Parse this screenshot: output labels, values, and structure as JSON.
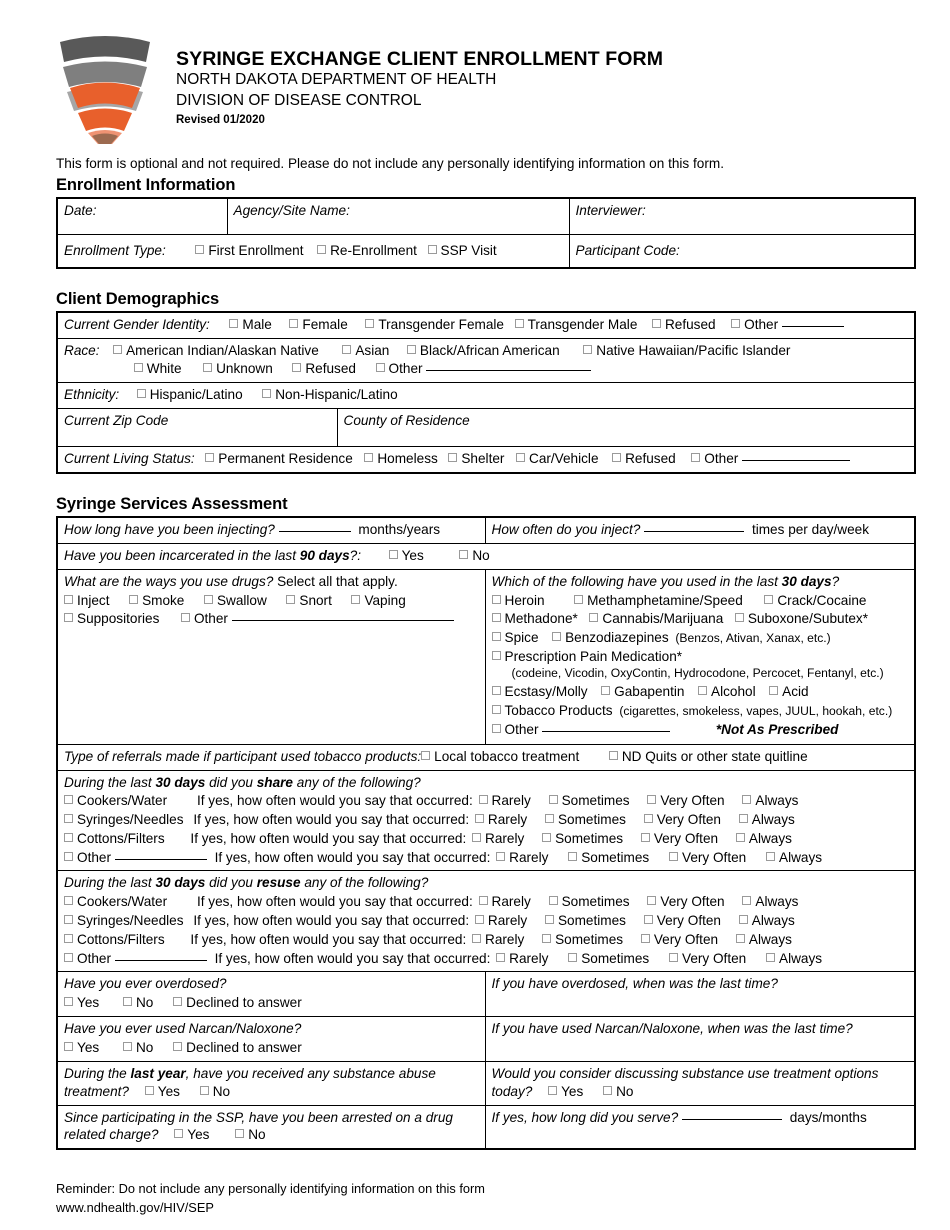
{
  "header": {
    "logo_name": "north-dakota-health-shield-logo",
    "title": "SYRINGE EXCHANGE CLIENT ENROLLMENT FORM",
    "org_line1": "NORTH DAKOTA DEPARTMENT OF HEALTH",
    "org_line2": "DIVISION OF DISEASE CONTROL",
    "revised": "Revised 01/2020",
    "colors": {
      "dark_gray": "#595959",
      "mid_gray": "#7f7f7f",
      "light_gray": "#a6a6a6",
      "orange": "#e8602c",
      "light_orange": "#ef9373",
      "brown": "#9c6a50"
    }
  },
  "intro": "This form is optional and not required.  Please do not include any personally identifying information on this form.",
  "sections": {
    "enrollment": {
      "heading": "Enrollment Information",
      "date_label": "Date:",
      "agency_label": "Agency/Site Name:",
      "interviewer_label": "Interviewer:",
      "enrollment_type_label": "Enrollment Type:",
      "enrollment_type_options": [
        "First Enrollment",
        "Re-Enrollment",
        "SSP Visit"
      ],
      "participant_code_label": "Participant Code:"
    },
    "demographics": {
      "heading": "Client Demographics",
      "gender_label": "Current Gender Identity:",
      "gender_options": [
        "Male",
        "Female",
        "Transgender Female",
        "Transgender Male",
        "Refused",
        "Other"
      ],
      "race_label": "Race:",
      "race_options_row1": [
        "American Indian/Alaskan Native",
        "Asian",
        "Black/African American",
        "Native Hawaiian/Pacific Islander"
      ],
      "race_options_row2": [
        "White",
        "Unknown",
        "Refused",
        "Other"
      ],
      "ethnicity_label": "Ethnicity:",
      "ethnicity_options": [
        "Hispanic/Latino",
        "Non-Hispanic/Latino"
      ],
      "zip_label": "Current Zip Code",
      "county_label": "County of Residence",
      "living_status_label": "Current Living Status:",
      "living_status_options": [
        "Permanent Residence",
        "Homeless",
        "Shelter",
        "Car/Vehicle",
        "Refused",
        "Other"
      ]
    },
    "assessment": {
      "heading": "Syringe Services Assessment",
      "how_long_q": "How long have you been injecting?",
      "how_long_unit": "months/years",
      "how_often_q": "How often do you inject?",
      "how_often_unit": "times per day/week",
      "incarcerated_q_a": "Have you been incarcerated in the last ",
      "incarcerated_q_bold": "90 days",
      "incarcerated_q_b": "?:",
      "incarcerated_options": [
        "Yes",
        "No"
      ],
      "ways_q": "What are the ways you use drugs?",
      "ways_q_tail": " Select all that apply.",
      "ways_options_row1": [
        "Inject",
        "Smoke",
        "Swallow",
        "Snort",
        "Vaping"
      ],
      "ways_options_row2": [
        "Suppositories",
        "Other"
      ],
      "used_q_a": "Which of the following have you used in the last ",
      "used_q_bold": "30 days",
      "used_q_b": "?",
      "used_row1": [
        "Heroin",
        "Methamphetamine/Speed",
        "Crack/Cocaine"
      ],
      "used_row2": [
        "Methadone*",
        "Cannabis/Marijuana",
        "Suboxone/Subutex*"
      ],
      "used_row3": [
        "Spice",
        "Benzodiazepines"
      ],
      "benzos_note": "(Benzos, Ativan, Xanax, etc.)",
      "rx_pain": "Prescription Pain Medication*",
      "rx_pain_note": "(codeine, Vicodin, OxyContin, Hydrocodone, Percocet, Fentanyl, etc.)",
      "used_row5": [
        "Ecstasy/Molly",
        "Gabapentin",
        "Alcohol",
        "Acid"
      ],
      "tobacco_label": "Tobacco Products",
      "tobacco_note": "(cigarettes, smokeless, vapes, JUUL, hookah, etc.)",
      "other_label": "Other",
      "not_as_prescribed": "*Not As Prescribed",
      "referral_label": "Type of referrals made if participant used tobacco products:",
      "referral_options": [
        "Local tobacco treatment",
        "ND Quits or other state quitline"
      ]
    },
    "share": {
      "q_a": "During the last ",
      "q_bold": "30 days",
      "q_mid": " did you ",
      "q_bold2": "share",
      "q_b": " any of the following?",
      "prompt": "If yes, how often would you say that occurred:",
      "items": [
        "Cookers/Water",
        "Syringes/Needles",
        "Cottons/Filters",
        "Other"
      ],
      "frequency": [
        "Rarely",
        "Sometimes",
        "Very Often",
        "Always"
      ]
    },
    "reuse": {
      "q_a": "During the last ",
      "q_bold": "30 days",
      "q_mid": " did you ",
      "q_bold2": "resuse",
      "q_b": " any of the following?",
      "prompt": "If yes, how often would you say that occurred:",
      "items": [
        "Cookers/Water",
        "Syringes/Needles",
        "Cottons/Filters",
        "Other"
      ],
      "frequency": [
        "Rarely",
        "Sometimes",
        "Very Often",
        "Always"
      ]
    },
    "overdose": {
      "q1": "Have you ever overdosed?",
      "q1_options": [
        "Yes",
        "No",
        "Declined to answer"
      ],
      "q1_right": "If you have overdosed, when was the last time?",
      "q2": "Have you ever used Narcan/Naloxone?",
      "q2_options": [
        "Yes",
        "No",
        "Declined to answer"
      ],
      "q2_right": "If you have used Narcan/Naloxone, when was the last time?"
    },
    "treatment": {
      "q3_a": "During the ",
      "q3_bold": "last year",
      "q3_b": ", have you received any substance abuse treatment?",
      "q3_options": [
        "Yes",
        "No"
      ],
      "q3_right": "Would you consider discussing substance use treatment options today?",
      "q3_right_options": [
        "Yes",
        "No"
      ],
      "q4": "Since participating in the SSP, have you been arrested on a drug related charge?",
      "q4_options": [
        "Yes",
        "No"
      ],
      "q4_right": "If yes, how long did you serve?",
      "q4_right_unit": "days/months"
    }
  },
  "footer": {
    "reminder": "Reminder:  Do not include any personally identifying information on this form",
    "url": "www.ndhealth.gov/HIV/SEP"
  }
}
